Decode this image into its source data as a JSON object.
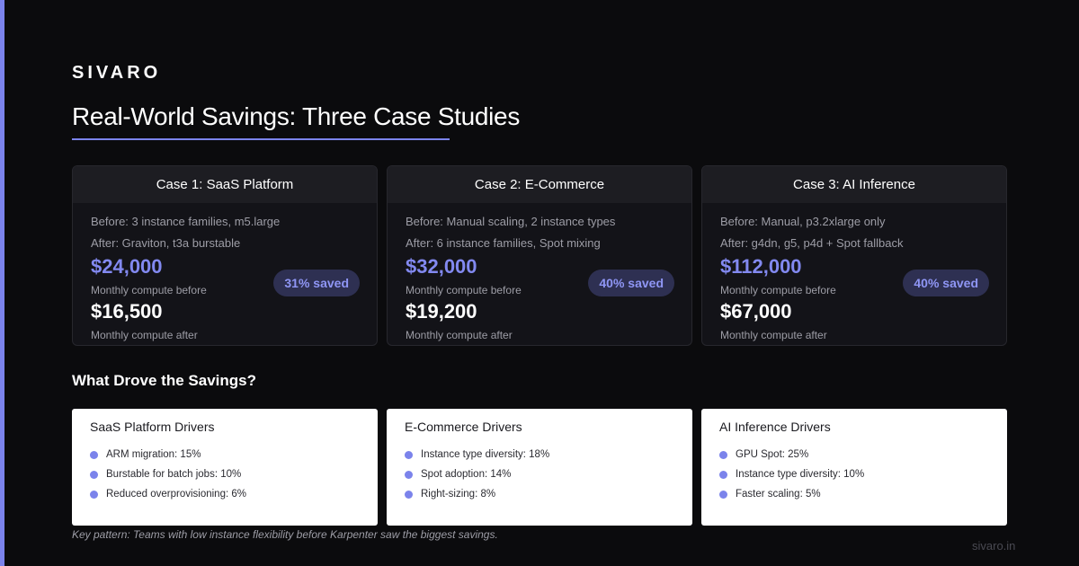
{
  "brand": "SIVARO",
  "title": "Real-World Savings: Three Case Studies",
  "accent_color": "#7b83eb",
  "cases": [
    {
      "header": "Case 1: SaaS Platform",
      "before_line": "Before: 3 instance families, m5.large",
      "after_line": "After: Graviton, t3a burstable",
      "amount_before": "$24,000",
      "label_before": "Monthly compute before",
      "amount_after": "$16,500",
      "label_after": "Monthly compute after",
      "badge": "31% saved"
    },
    {
      "header": "Case 2: E-Commerce",
      "before_line": "Before: Manual scaling, 2 instance types",
      "after_line": "After: 6 instance families, Spot mixing",
      "amount_before": "$32,000",
      "label_before": "Monthly compute before",
      "amount_after": "$19,200",
      "label_after": "Monthly compute after",
      "badge": "40% saved"
    },
    {
      "header": "Case 3: AI Inference",
      "before_line": "Before: Manual, p3.2xlarge only",
      "after_line": "After: g4dn, g5, p4d + Spot fallback",
      "amount_before": "$112,000",
      "label_before": "Monthly compute before",
      "amount_after": "$67,000",
      "label_after": "Monthly compute after",
      "badge": "40% saved"
    }
  ],
  "drivers_section_title": "What Drove the Savings?",
  "drivers": [
    {
      "title": "SaaS Platform Drivers",
      "items": [
        "ARM migration: 15%",
        "Burstable for batch jobs: 10%",
        "Reduced overprovisioning: 6%"
      ]
    },
    {
      "title": "E-Commerce Drivers",
      "items": [
        "Instance type diversity: 18%",
        "Spot adoption: 14%",
        "Right-sizing: 8%"
      ]
    },
    {
      "title": "AI Inference Drivers",
      "items": [
        "GPU Spot: 25%",
        "Instance type diversity: 10%",
        "Faster scaling: 5%"
      ]
    }
  ],
  "footnote": "Key pattern: Teams with low instance flexibility before Karpenter saw the biggest savings.",
  "site": "sivaro.in"
}
